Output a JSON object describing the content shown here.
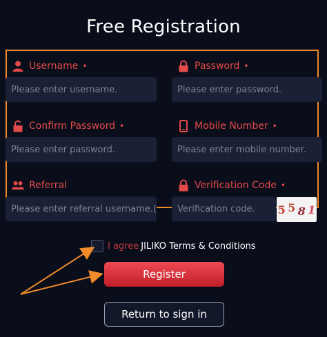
{
  "title": "Free Registration",
  "fields": {
    "username": {
      "label": "Username",
      "required": "•",
      "placeholder": "Please enter username."
    },
    "password": {
      "label": "Password",
      "required": "•",
      "placeholder": "Please enter password."
    },
    "confirm_password": {
      "label": "Confirm Password",
      "required": "•",
      "placeholder": "Please enter password."
    },
    "mobile": {
      "label": "Mobile Number",
      "required": "•",
      "placeholder": "Please enter mobile number."
    },
    "referral": {
      "label": "Referral",
      "placeholder": "Please enter referral username.(Optio"
    },
    "verification": {
      "label": "Verification Code",
      "required": "•",
      "placeholder": "Verification code.",
      "captcha": [
        "5",
        "5",
        "8",
        "1"
      ]
    }
  },
  "agree": {
    "prefix": "I agree",
    "link": "JILIKO Terms & Conditions"
  },
  "buttons": {
    "register": "Register",
    "return": "Return to sign in"
  },
  "colors": {
    "accent_red": "#e34a4a",
    "annotation_orange": "#f08a2a",
    "background": "#0a0d1a",
    "input_bg": "#1a2035"
  },
  "icons": {
    "username": "user-icon",
    "password": "lock-icon",
    "confirm_password": "unlock-icon",
    "mobile": "phone-icon",
    "referral": "users-icon",
    "verification": "lock-icon"
  }
}
